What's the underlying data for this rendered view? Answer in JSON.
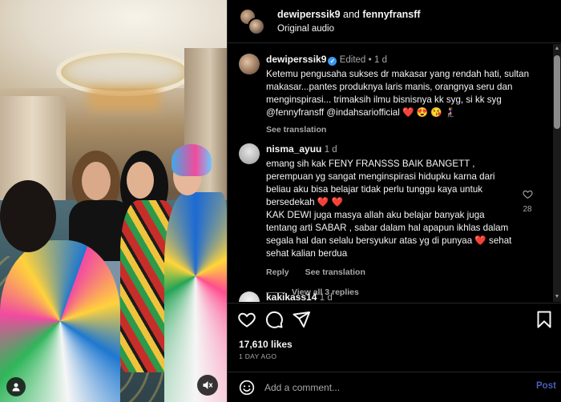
{
  "header": {
    "user1": "dewiperssik9",
    "joiner": "and",
    "user2": "fennyfransff",
    "subtitle": "Original audio"
  },
  "caption": {
    "username": "dewiperssik9",
    "verified_icon": "verified-badge-icon",
    "edited": "Edited",
    "time": "1 d",
    "text": "Ketemu pengusaha sukses dr makasar yang rendah hati, sultan makasar...pantes produknya laris manis, orangnya seru dan menginspirasi... trimaksih ilmu bisnisnya kk syg, si kk syg @fennyfransff @indahsariofficial ❤️ 😍 😘 🧎‍♀️",
    "see_translation": "See translation"
  },
  "comment": {
    "username": "nisma_ayuu",
    "time": "1 d",
    "text": "emang sih kak FENY FRANSSS BAIK BANGETT , perempuan yg sangat menginspirasi hidupku karna dari beliau aku bisa belajar tidak perlu tunggu kaya untuk bersedekah ❤️ ❤️\nKAK DEWI juga masya allah aku belajar banyak juga tentang arti SABAR , sabar dalam hal apapun ikhlas dalam segala hal dan selalu bersyukur atas yg di punyaa ❤️ sehat sehat kalian berdua",
    "reply": "Reply",
    "see_translation": "See translation",
    "view_replies": "View all 3 replies",
    "likes": "28"
  },
  "next_comment": {
    "username": "kakikass14",
    "time": "1 d"
  },
  "actions": {
    "icons": [
      "heart-icon",
      "comment-icon",
      "share-icon",
      "bookmark-icon"
    ],
    "likes": "17,610 likes",
    "timestamp": "1 DAY AGO"
  },
  "composer": {
    "placeholder": "Add a comment...",
    "post_label": "Post"
  },
  "colors": {
    "background": "#000000",
    "text": "#f5f5f5",
    "muted": "#a8a8a8",
    "heart": "#ff3040",
    "verified": "#3897f0",
    "post": "#4a5dba"
  }
}
